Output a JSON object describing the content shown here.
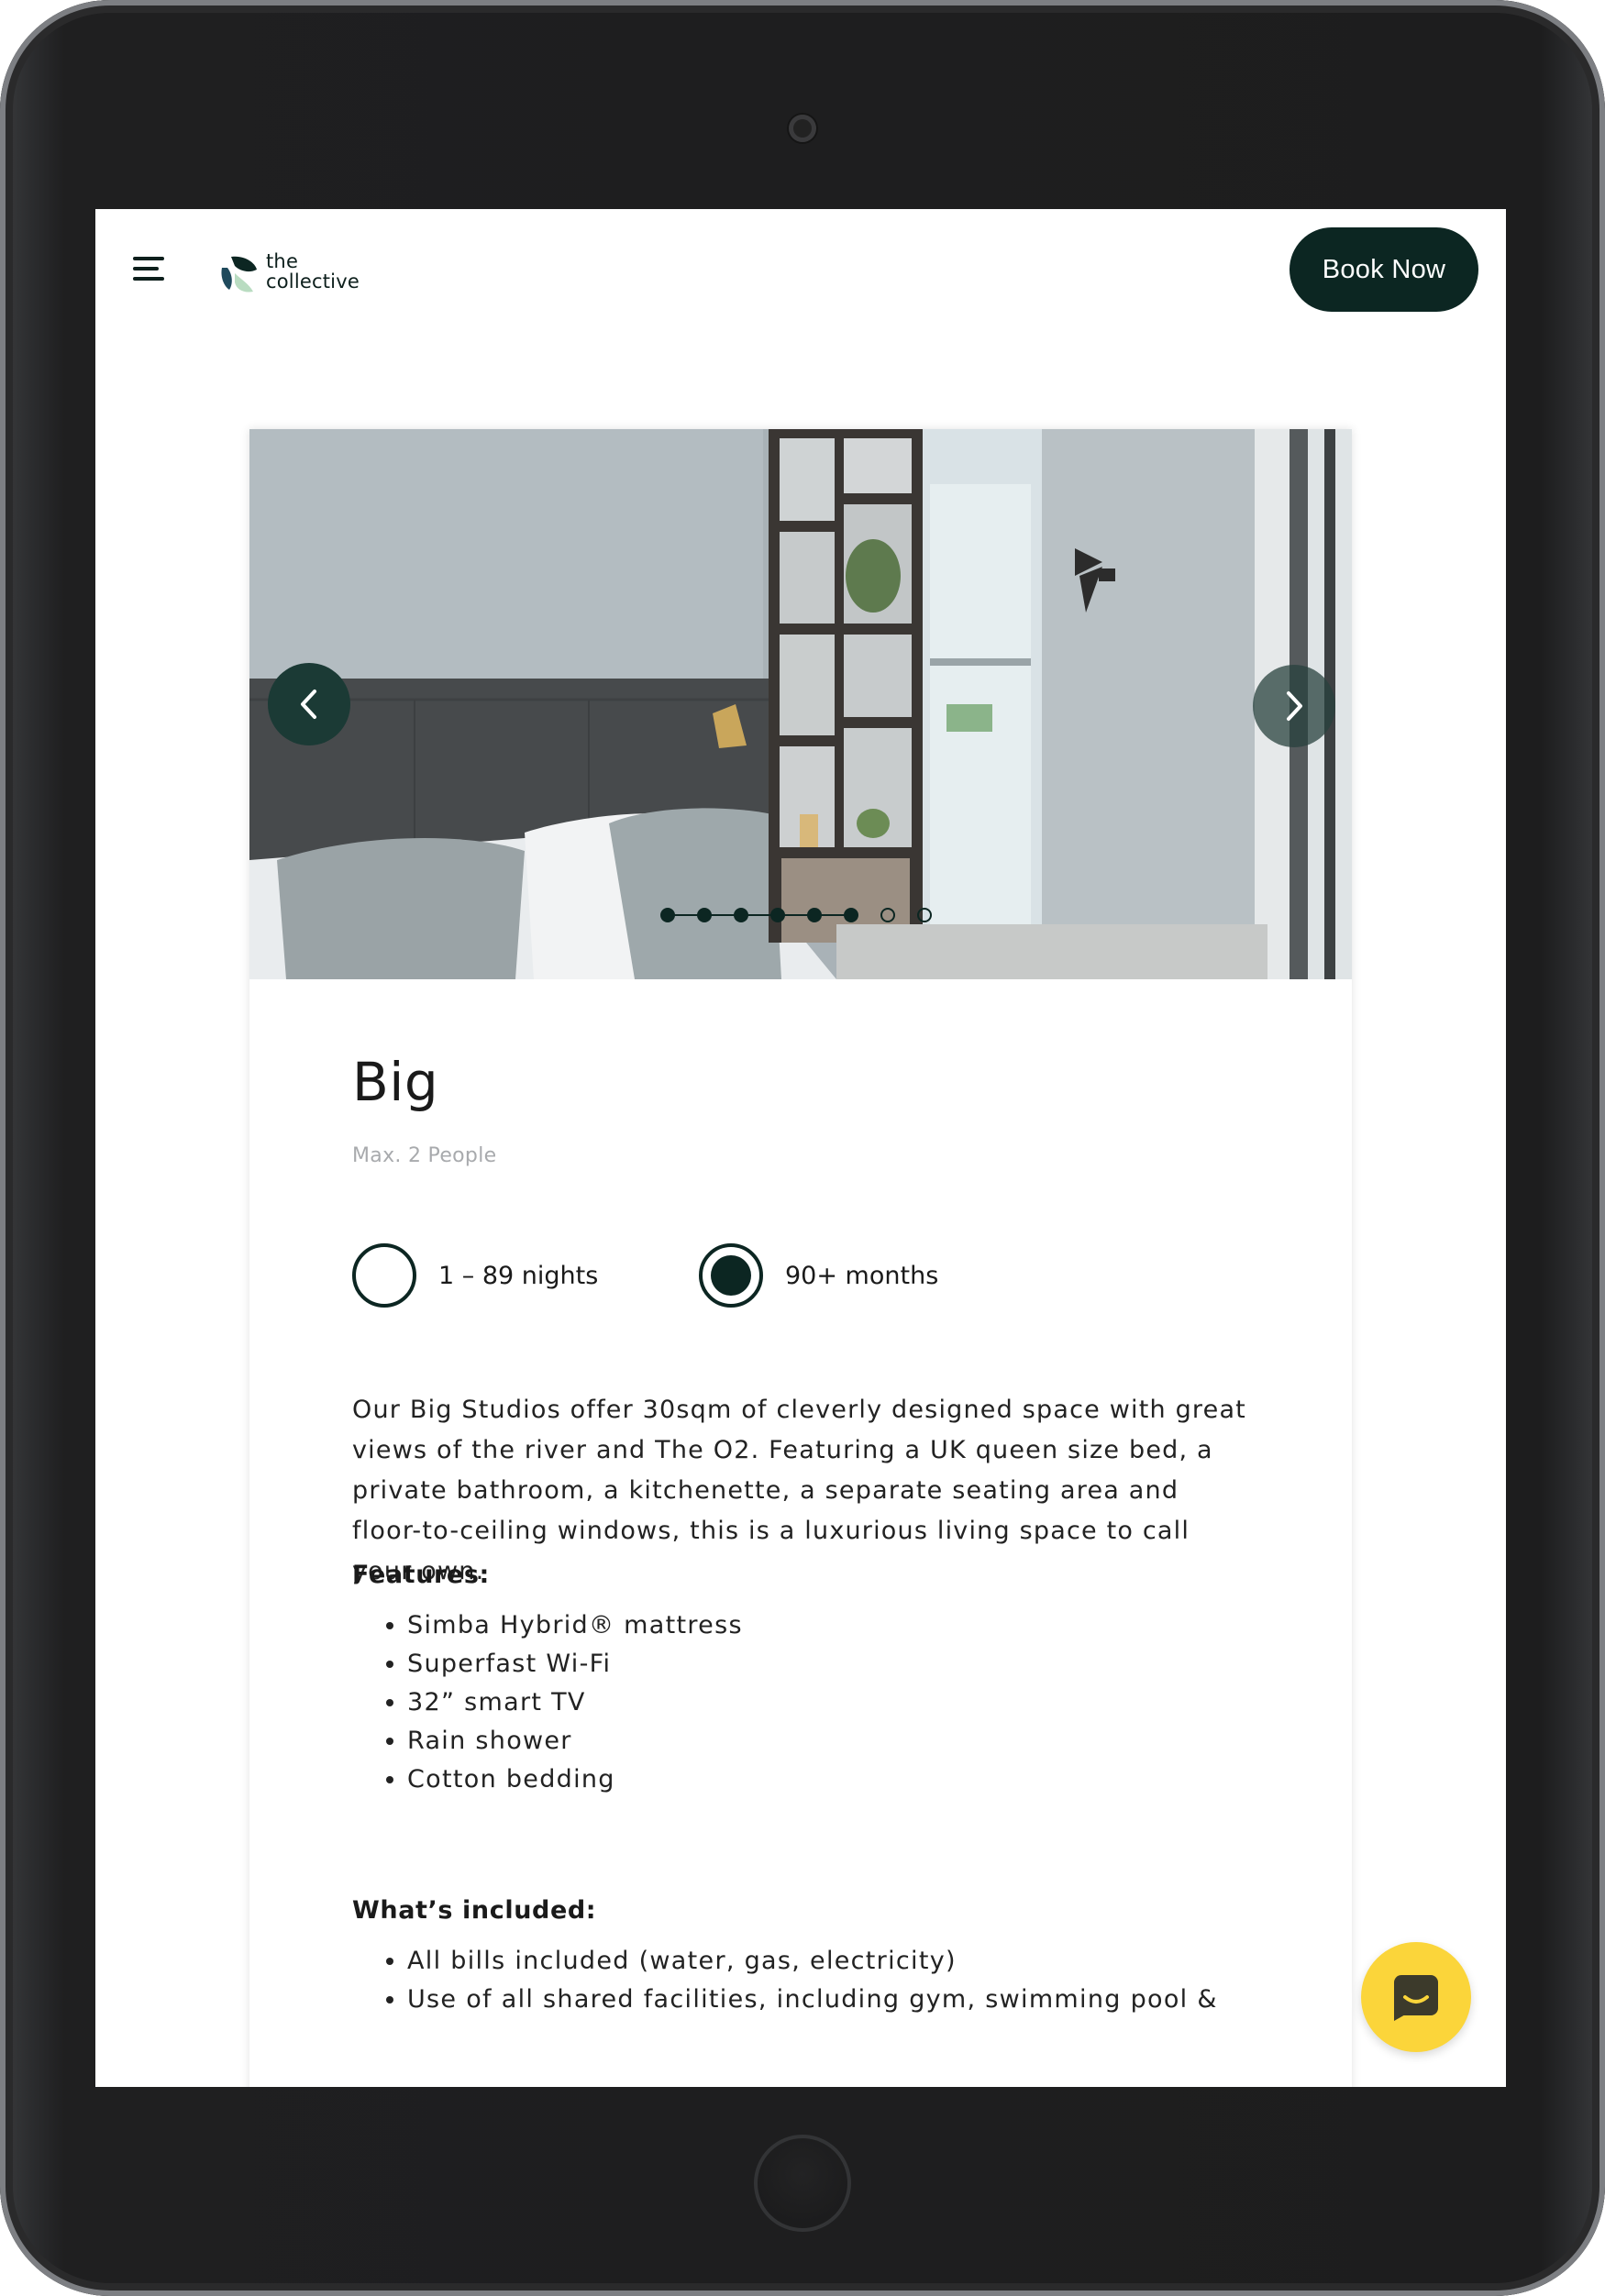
{
  "header": {
    "logo_text_line1": "the",
    "logo_text_line2": "collective",
    "book_button_label": "Book Now"
  },
  "carousel": {
    "total_slides": 8,
    "current_slide": 6
  },
  "room": {
    "title": "Big",
    "capacity": "Max. 2 People",
    "options": [
      {
        "label": "1 – 89 nights",
        "selected": false
      },
      {
        "label": "90+ months",
        "selected": true
      }
    ],
    "description": "Our Big Studios offer 30sqm of cleverly designed space with great views of the river and The O2. Featuring a UK queen size bed, a private bathroom, a kitchenette, a separate seating area and floor-to-ceiling windows, this is a luxurious living space to call your own.",
    "features_title": "Features:",
    "features": [
      "Simba Hybrid® mattress",
      "Superfast Wi-Fi",
      "32” smart TV",
      "Rain shower",
      "Cotton bedding"
    ],
    "included_title": "What’s included:",
    "included": [
      "All bills included (water, gas, electricity)",
      "Use of all shared facilities, including gym, swimming pool &"
    ]
  },
  "colors": {
    "brand_dark": "#0c2622",
    "chat_yellow": "#fbd53a"
  },
  "icons": [
    "menu-icon",
    "logo-icon",
    "chevron-left-icon",
    "chevron-right-icon",
    "chat-icon"
  ]
}
